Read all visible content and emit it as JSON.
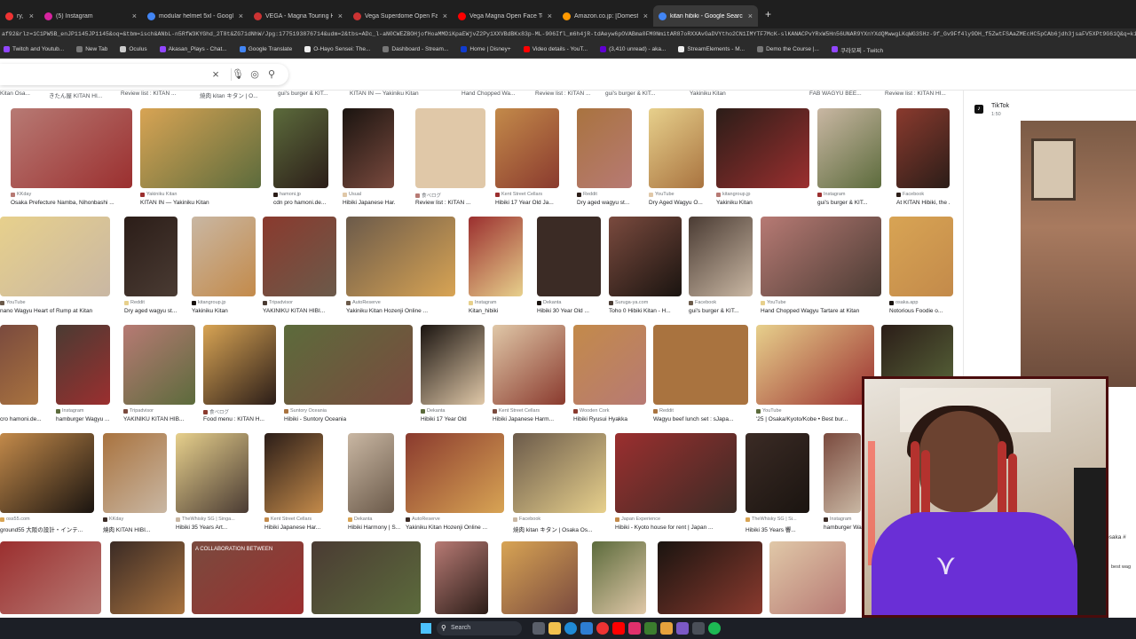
{
  "browser": {
    "tabs": [
      {
        "label": "ry, jam3...",
        "color": "#e33"
      },
      {
        "label": "(5) Instagram",
        "color": "#d6249f"
      },
      {
        "label": "modular helmet 5xl - Google Se...",
        "color": "#4285f4"
      },
      {
        "label": "VEGA - Magna Touring Helmet...",
        "color": "#cc3333"
      },
      {
        "label": "Vega Superdome Open Face H...",
        "color": "#cc3333"
      },
      {
        "label": "Vega Magna Open Face Touring...",
        "color": "#ff0000"
      },
      {
        "label": "Amazon.co.jp: [Domestic SG/P...",
        "color": "#ff9900"
      },
      {
        "label": "kitan hibiki - Google Search",
        "color": "#4285f4"
      }
    ],
    "new_tab_symbol": "+",
    "url": "af92&rlz=1C1PWSB_enJP1145JP1145&oq=&tbm=isch&ANbL-n5RfW3KYGhd_2T8t&ZG71dNhW/Jpg:1775193876714&udm=2&tbs=ADc_l-aN0CWEZBOHjofHoaMMDiKpaEWjvZ2Py1XXVBdBKx83p-ML-906Ifl_m6h4jR-tdAeyw6pOVABma0FM0NmitAR87oRXXAvGaDVYtho2CN1IMYTF7McK-slKANACPvYRxW5Hn56UNAR9YXnYXdQMwwgLKqWG3SHz-9f_Gv9Ff4ly9DH_f5ZwtFSAaZMEcHC5pCAb6jdh3jsaFV5XPt9G61Q&q=kitan+hibiki",
    "bookmarks": [
      {
        "label": "Twitch and Youtub...",
        "color": "#9146ff"
      },
      {
        "label": "New Tab",
        "color": "#777"
      },
      {
        "label": "Oculus",
        "color": "#ccc"
      },
      {
        "label": "Akasan_Plays - Chat...",
        "color": "#9146ff"
      },
      {
        "label": "Google Translate",
        "color": "#4285f4"
      },
      {
        "label": "O-Hayo Sensei: The...",
        "color": "#eee"
      },
      {
        "label": "Dashboard - Stream...",
        "color": "#777"
      },
      {
        "label": "Home | Disney+",
        "color": "#113ccf"
      },
      {
        "label": "Video details - YouT...",
        "color": "#ff0000"
      },
      {
        "label": "(3,410 unread) - aka...",
        "color": "#6001d2"
      },
      {
        "label": "StreamElements - M...",
        "color": "#eee"
      },
      {
        "label": "Demo the Course |...",
        "color": "#777"
      },
      {
        "label": "쿠라모찌 - Twitch",
        "color": "#9146ff"
      }
    ]
  },
  "search": {
    "clear_icon": "×",
    "mic_icon": "🎙",
    "lens_icon": "◎",
    "search_icon": "⚲"
  },
  "top_labels": [
    "Kitan Osa...",
    "きたん屋 KITAN HI...",
    "Review list : KITAN ...",
    "焼肉 kitan キタン | O...",
    "gui's burger & KIT...",
    "KITAN IN — Yakiniku Kitan",
    "Hand Chopped Wa...",
    "Review list : KITAN ...",
    "gui's burger & KIT...",
    "Yakiniku Kitan",
    "FAB WAGYU BEE...",
    "Review list : KITAN HI..."
  ],
  "rows": [
    [
      {
        "src": "KKday",
        "cap": "Osaka Prefecture Namba, Nihonbashi ..."
      },
      {
        "src": "Yakiniku Kitan",
        "cap": "KITAN IN — Yakiniku Kitan"
      },
      {
        "src": "hamoni.jp",
        "cap": "cdn pro hamoni.de..."
      },
      {
        "src": "Usual",
        "cap": "Hibiki Japanese Har..."
      },
      {
        "src": "食べログ",
        "cap": "Review list : KITAN ..."
      },
      {
        "src": "Kent Street Cellars",
        "cap": "Hibiki 17 Year Old Ja..."
      },
      {
        "src": "Reddit",
        "cap": "Dry aged wagyu st..."
      },
      {
        "src": "YouTube",
        "cap": "Dry Aged Wagyu O..."
      },
      {
        "src": "kitangroup.jp",
        "cap": "Yakiniku Kitan"
      },
      {
        "src": "Instagram",
        "cap": "gui's burger & KIT..."
      },
      {
        "src": "Facebook",
        "cap": "At KITAN Hibiki, the ..."
      }
    ],
    [
      {
        "src": "YouTube",
        "cap": "nano Wagyu Heart of Rump at Kitan"
      },
      {
        "src": "Reddit",
        "cap": "Dry aged wagyu st..."
      },
      {
        "src": "kitangroup.jp",
        "cap": "Yakiniku Kitan"
      },
      {
        "src": "Tripadvisor",
        "cap": "YAKINIKU KITAN HIBI..."
      },
      {
        "src": "AutoReserve",
        "cap": "Yakiniku Kitan Hozenji Online ..."
      },
      {
        "src": "Instagram",
        "cap": "Kitan_hibiki"
      },
      {
        "src": "Dekanta",
        "cap": "Hibiki 30 Year Old ..."
      },
      {
        "src": "Suruga-ya.com",
        "cap": "Toho 0 Hibiki Kitan - H..."
      },
      {
        "src": "Facebook",
        "cap": "gui's burger & KIT..."
      },
      {
        "src": "YouTube",
        "cap": "Hand Chopped Wagyu Tartare at Kitan"
      },
      {
        "src": "osaka.app",
        "cap": "Notorious Foodie o..."
      }
    ],
    [
      {
        "src": "",
        "cap": "cro hamoni.de..."
      },
      {
        "src": "Instagram",
        "cap": "hamburger Wagyu ..."
      },
      {
        "src": "Tripadvisor",
        "cap": "YAKINIKU KITAN HIB..."
      },
      {
        "src": "食べログ",
        "cap": "Food menu : KITAN H..."
      },
      {
        "src": "Suntory Oceania",
        "cap": "Hibiki - Suntory Oceania"
      },
      {
        "src": "Dekanta",
        "cap": "Hibiki 17 Year Old"
      },
      {
        "src": "Kent Street Cellars",
        "cap": "Hibiki Japanese Harm..."
      },
      {
        "src": "Wooden Cork",
        "cap": "Hibiki Ryusui Hyakka"
      },
      {
        "src": "Reddit",
        "cap": "Wagyu beef lunch set : sJapa..."
      },
      {
        "src": "YouTube",
        "cap": "'25 | Osaka/Kyoto/Kobe • Best bur..."
      },
      {
        "src": "",
        "cap": ""
      }
    ],
    [
      {
        "src": "oss55.com",
        "cap": "ground55 大阪の設計・インテ..."
      },
      {
        "src": "KKday",
        "cap": "燒肉 KITAN HIBI..."
      },
      {
        "src": "TheWhisky SG | Singa...",
        "cap": "Hibiki 35 Years Art..."
      },
      {
        "src": "Kent Street Cellars",
        "cap": "Hibiki Japanese Har..."
      },
      {
        "src": "Dekanta",
        "cap": "Hibiki Harmony | S..."
      },
      {
        "src": "AutoReserve",
        "cap": "Yakiniku Kitan Hozenji Online ..."
      },
      {
        "src": "Facebook",
        "cap": "焼肉 kitan キタン | Osaka Os..."
      },
      {
        "src": "Japan Experience",
        "cap": "Hibiki - Kyoto house for rent | Japan ..."
      },
      {
        "src": "TheWhisky SG | Si...",
        "cap": "Hibiki 35 Years 響..."
      },
      {
        "src": "Instagram",
        "cap": "hamburger Wa..."
      }
    ],
    [
      {
        "src": "",
        "cap": ""
      },
      {
        "src": "",
        "cap": ""
      },
      {
        "src": "",
        "cap": "A COLLABORATION BETWEEN"
      },
      {
        "src": "",
        "cap": ""
      },
      {
        "src": "",
        "cap": ""
      },
      {
        "src": "",
        "cap": ""
      },
      {
        "src": "",
        "cap": ""
      },
      {
        "src": "",
        "cap": ""
      },
      {
        "src": "",
        "cap": ""
      }
    ]
  ],
  "panel": {
    "source": "TikTok",
    "meta": "1:50",
    "text1": "osaka #",
    "text2": "best wag"
  },
  "taskbar": {
    "search_label": "Search"
  },
  "colors": {
    "chrome_bg": "#1f1f1f",
    "accent_blue": "#4285f4",
    "webcam_border": "#4a0c0c",
    "shirt_purple": "#6a2fd6"
  }
}
